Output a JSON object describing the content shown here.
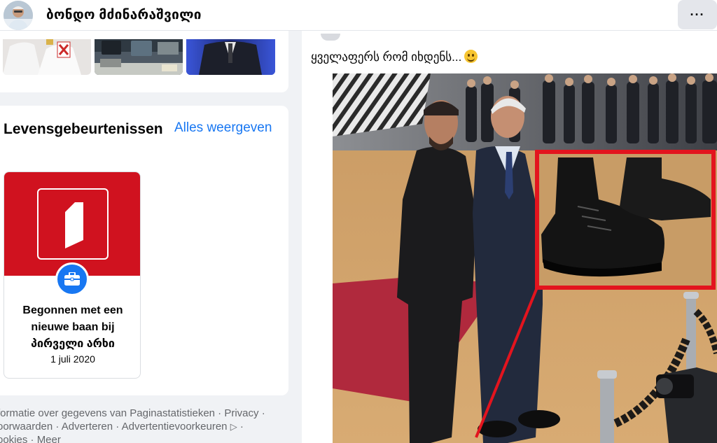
{
  "header": {
    "profile_name": "ბონდო მძინარაშვილი",
    "more_label": "···"
  },
  "life_events": {
    "title": "Levensgebeurtenissen",
    "see_all_label": "Alles weergeven",
    "items": [
      {
        "text": "Begonnen met een nieuwe baan bij პირველი არხი",
        "date": "1 juli 2020",
        "icon": "briefcase-icon"
      }
    ]
  },
  "footer": {
    "line1": "formatie over gegevens van Paginastatistieken · Privacy ·",
    "line2": "oorwaarden · Adverteren · Advertentievoorkeuren",
    "line3": "ookies · Meer"
  },
  "post": {
    "text": "ყველაფერს რომ იხდენს...",
    "emoji": "smiling-face-icon"
  },
  "colors": {
    "accent": "#1877f2",
    "cover_red": "#d0121f",
    "highlight_red": "#e3141e",
    "background": "#f0f2f5"
  }
}
